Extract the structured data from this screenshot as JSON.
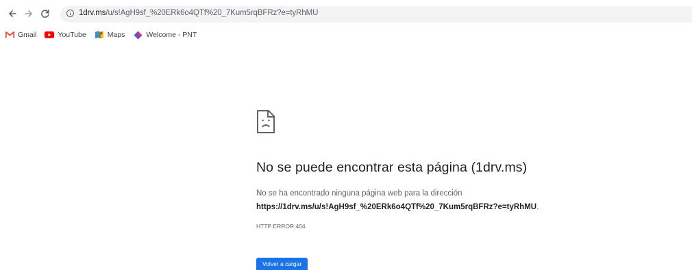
{
  "browser": {
    "nav": {
      "back_icon": "back-arrow-icon",
      "forward_icon": "forward-arrow-icon",
      "reload_icon": "reload-icon"
    },
    "address": {
      "icon": "info-icon",
      "host": "1drv.ms",
      "path": "/u/s!AgH9sf_%20ERk6o4QTf%20_7Kum5rqBFRz?e=tyRhMU"
    },
    "bookmarks": [
      {
        "label": "Gmail",
        "icon": "gmail-icon"
      },
      {
        "label": "YouTube",
        "icon": "youtube-icon"
      },
      {
        "label": "Maps",
        "icon": "maps-icon"
      },
      {
        "label": "Welcome - PNT",
        "icon": "pnt-icon"
      }
    ]
  },
  "error_page": {
    "icon": "sad-page-icon",
    "title": "No se puede encontrar esta página (1drv.ms)",
    "message_line1": "No se ha encontrado ninguna página web para la dirección",
    "message_url": "https://1drv.ms/u/s!AgH9sf_%20ERk6o4QTf%20_7Kum5rqBFRz?e=tyRhMU",
    "message_end": ".",
    "error_code": "HTTP ERROR 404",
    "reload_button": "Volver a cargar"
  },
  "colors": {
    "accent": "#1a73e8",
    "omnibox_bg": "#f1f3f4",
    "text_primary": "#202124",
    "text_secondary": "#5f6368"
  }
}
